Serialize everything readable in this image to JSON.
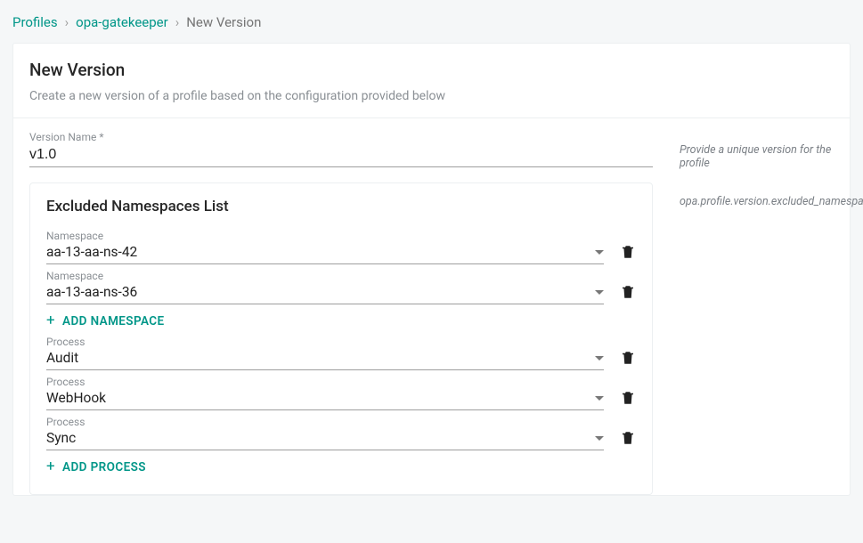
{
  "breadcrumb": {
    "profiles": "Profiles",
    "profile_name": "opa-gatekeeper",
    "current": "New Version",
    "sep": "›"
  },
  "header": {
    "title": "New Version",
    "subtitle": "Create a new version of a profile based on the configuration provided below"
  },
  "version_field": {
    "label": "Version Name *",
    "value": "v1.0",
    "hint": "Provide a unique version for the profile"
  },
  "excluded_panel": {
    "title": "Excluded Namespaces List",
    "hint": "opa.profile.version.excluded_namespaces",
    "namespaces": [
      {
        "label": "Namespace",
        "value": "aa-13-aa-ns-42"
      },
      {
        "label": "Namespace",
        "value": "aa-13-aa-ns-36"
      }
    ],
    "add_namespace": "ADD NAMESPACE",
    "processes": [
      {
        "label": "Process",
        "value": "Audit"
      },
      {
        "label": "Process",
        "value": "WebHook"
      },
      {
        "label": "Process",
        "value": "Sync"
      }
    ],
    "add_process": "ADD PROCESS"
  }
}
